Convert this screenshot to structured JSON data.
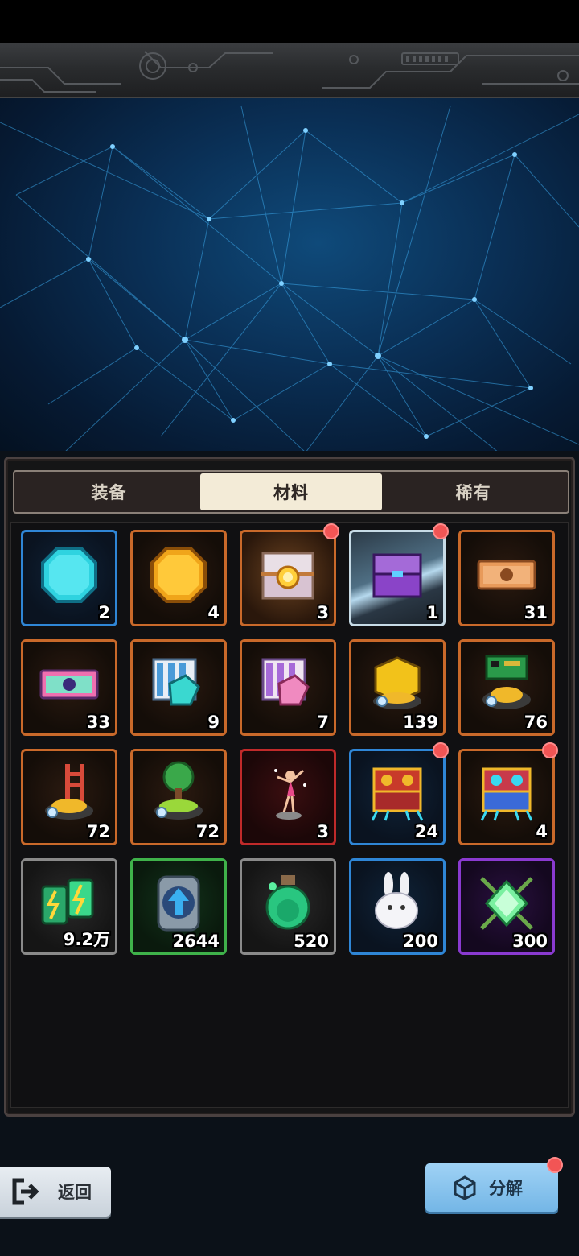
{
  "tabs": [
    {
      "label": "装备",
      "active": false
    },
    {
      "label": "材料",
      "active": true
    },
    {
      "label": "稀有",
      "active": false
    }
  ],
  "items": [
    {
      "icon": "cyan-gem-icon",
      "count": "2",
      "rarity": "blue",
      "badge": false
    },
    {
      "icon": "gold-coin-icon",
      "count": "4",
      "rarity": "orange",
      "badge": false
    },
    {
      "icon": "gold-treasure-chest-icon",
      "count": "3",
      "rarity": "orange-glow",
      "badge": true
    },
    {
      "icon": "purple-treasure-chest-icon",
      "count": "1",
      "rarity": "silver",
      "badge": true
    },
    {
      "icon": "bronze-ticket-icon",
      "count": "31",
      "rarity": "orange",
      "badge": false
    },
    {
      "icon": "rainbow-ticket-icon",
      "count": "33",
      "rarity": "orange",
      "badge": false
    },
    {
      "icon": "cyan-exchange-coupon-icon",
      "count": "9",
      "rarity": "orange",
      "badge": false
    },
    {
      "icon": "pink-exchange-coupon-icon",
      "count": "7",
      "rarity": "orange",
      "badge": false
    },
    {
      "icon": "gold-cube-pile-icon",
      "count": "139",
      "rarity": "orange",
      "badge": false
    },
    {
      "icon": "circuit-board-pile-icon",
      "count": "76",
      "rarity": "orange",
      "badge": false
    },
    {
      "icon": "ladder-pile-icon",
      "count": "72",
      "rarity": "orange",
      "badge": false
    },
    {
      "icon": "tree-pile-icon",
      "count": "72",
      "rarity": "orange",
      "badge": false
    },
    {
      "icon": "dancer-figurine-icon",
      "count": "3",
      "rarity": "red",
      "badge": false
    },
    {
      "icon": "red-mech-chest-icon",
      "count": "24",
      "rarity": "blue",
      "badge": true
    },
    {
      "icon": "blue-mech-chest-icon",
      "count": "4",
      "rarity": "orange",
      "badge": true
    },
    {
      "icon": "energy-battery-icon",
      "count": "9.2万",
      "rarity": "gray",
      "badge": false
    },
    {
      "icon": "blue-arrow-chip-icon",
      "count": "2644",
      "rarity": "green",
      "badge": false
    },
    {
      "icon": "exp-potion-icon",
      "count": "520",
      "rarity": "gray",
      "badge": false
    },
    {
      "icon": "white-rabbit-icon",
      "count": "200",
      "rarity": "blue",
      "badge": false
    },
    {
      "icon": "green-crystal-icon",
      "count": "300",
      "rarity": "purple",
      "badge": false
    }
  ],
  "footer": {
    "back_label": "返回",
    "decompose_label": "分解",
    "decompose_badge": true
  },
  "colors": {
    "rarity_orange": "#c9692a",
    "rarity_blue": "#2f86d6",
    "rarity_red": "#c02a2a",
    "rarity_green": "#3fb24a",
    "rarity_gray": "#8a8a8a",
    "rarity_purple": "#8a3ad0",
    "badge_red": "#f25555",
    "tab_active": "#f3ebd7",
    "decompose_button": "#74b6e6"
  }
}
